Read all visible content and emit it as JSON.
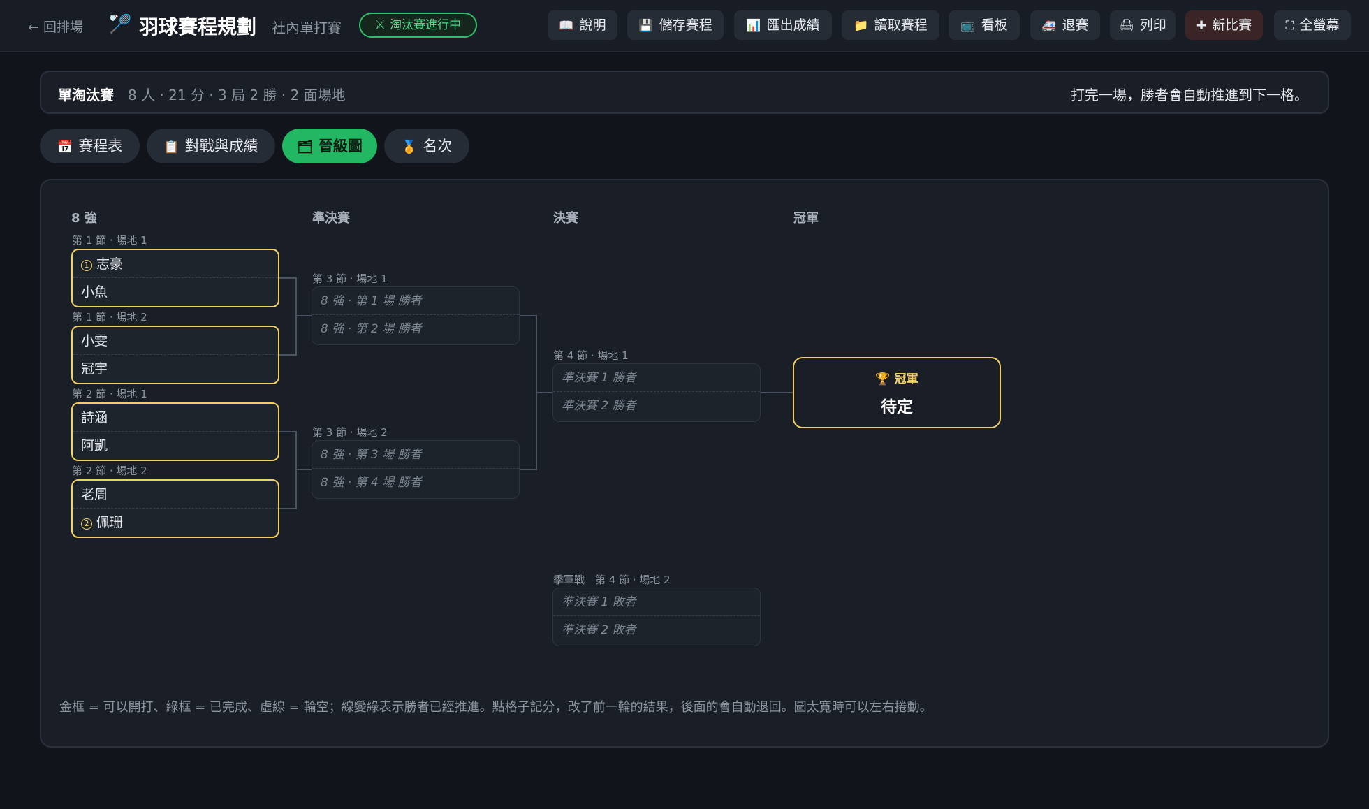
{
  "header": {
    "back_label": "← 回排場",
    "title": "羽球賽程規劃",
    "subtitle": "社內單打賽",
    "status_badge": "淘汰賽進行中",
    "toolbar": [
      {
        "name": "help-button",
        "icon": "book-icon",
        "glyph": "📖",
        "label": "說明"
      },
      {
        "name": "save-schedule-button",
        "icon": "floppy-disk-icon",
        "glyph": "💾",
        "label": "儲存賽程"
      },
      {
        "name": "export-results-button",
        "icon": "bar-chart-icon",
        "glyph": "📊",
        "label": "匯出成績"
      },
      {
        "name": "load-schedule-button",
        "icon": "folder-icon",
        "glyph": "📁",
        "label": "讀取賽程"
      },
      {
        "name": "scoreboard-button",
        "icon": "tv-icon",
        "glyph": "📺",
        "label": "看板"
      },
      {
        "name": "withdraw-button",
        "icon": "ambulance-icon",
        "glyph": "🚑",
        "label": "退賽"
      },
      {
        "name": "print-button",
        "icon": "printer-icon",
        "glyph": "🖨",
        "label": "列印"
      },
      {
        "name": "new-match-button",
        "icon": "plus-icon",
        "glyph": "✚",
        "label": "新比賽"
      },
      {
        "name": "fullscreen-button",
        "icon": "fullscreen-icon",
        "glyph": "⛶",
        "label": "全螢幕"
      }
    ]
  },
  "info": {
    "mode": "單淘汰賽",
    "meta": "8 人 · 21 分 · 3 局 2 勝 · 2 面場地",
    "hint": "打完一場，勝者會自動推進到下一格。"
  },
  "tabs": [
    {
      "name": "tab-schedule",
      "icon": "calendar-icon",
      "glyph": "📅",
      "label": "賽程表"
    },
    {
      "name": "tab-matches-results",
      "icon": "clipboard-icon",
      "glyph": "📋",
      "label": "對戰與成績"
    },
    {
      "name": "tab-bracket",
      "icon": "bracket-icon",
      "glyph": "🗂",
      "label": "晉級圖"
    },
    {
      "name": "tab-ranking",
      "icon": "medal-icon",
      "glyph": "🏅",
      "label": "名次"
    }
  ],
  "bracket": {
    "rounds": [
      "8 強",
      "準決賽",
      "決賽",
      "冠軍"
    ],
    "quarterfinals": [
      {
        "label": "第 1 節 · 場地 1",
        "top": "志豪",
        "top_seed": "1",
        "bottom": "小魚"
      },
      {
        "label": "第 1 節 · 場地 2",
        "top": "小雯",
        "bottom": "冠宇"
      },
      {
        "label": "第 2 節 · 場地 1",
        "top": "詩涵",
        "bottom": "阿凱"
      },
      {
        "label": "第 2 節 · 場地 2",
        "top": "老周",
        "bottom": "佩珊",
        "bottom_seed": "2"
      }
    ],
    "semifinals": [
      {
        "label": "第 3 節 · 場地 1",
        "top": "8 強 · 第 1 場 勝者",
        "bottom": "8 強 · 第 2 場 勝者"
      },
      {
        "label": "第 3 節 · 場地 2",
        "top": "8 強 · 第 3 場 勝者",
        "bottom": "8 強 · 第 4 場 勝者"
      }
    ],
    "final": {
      "label": "第 4 節 · 場地 1",
      "top": "準決賽 1 勝者",
      "bottom": "準決賽 2 勝者"
    },
    "third_place": {
      "label": "季軍戰　第 4 節 · 場地 2",
      "top": "準決賽 1 敗者",
      "bottom": "準決賽 2 敗者"
    },
    "champion": {
      "label": "冠軍",
      "value": "待定"
    }
  },
  "legend_note": "金框 = 可以開打、綠框 = 已完成、虛線 = 輪空；線變綠表示勝者已經推進。點格子記分，改了前一輪的結果，後面的會自動退回。圖太寬時可以左右捲動。"
}
